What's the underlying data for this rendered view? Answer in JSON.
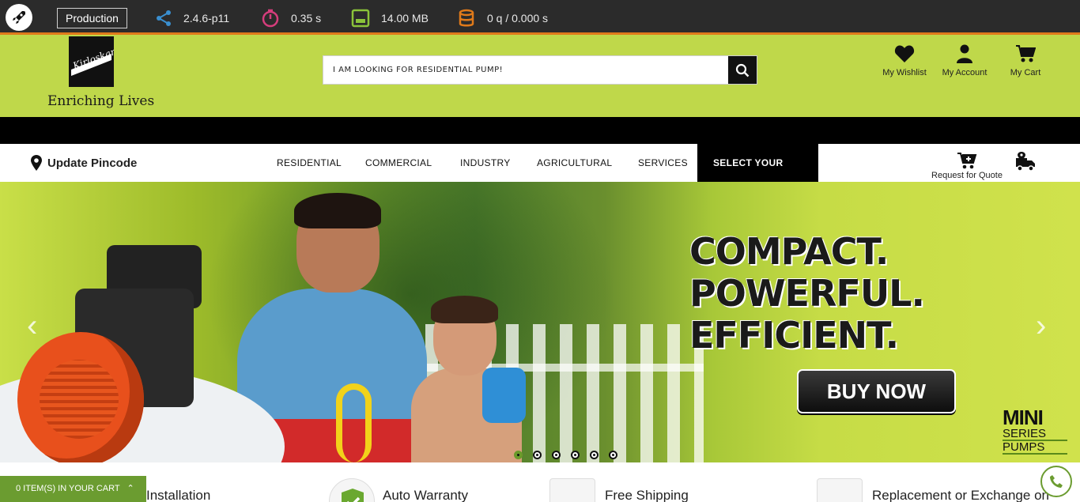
{
  "devbar": {
    "environment": "Production",
    "version": "2.4.6-p11",
    "time": "0.35 s",
    "memory": "14.00 MB",
    "queries": "0 q / 0.000 s"
  },
  "header": {
    "logo_script": "Kirloskar",
    "logo_tagline": "Enriching Lives",
    "search": {
      "value": "I AM LOOKING FOR RESIDENTIAL PUMP!",
      "icon": "search-icon"
    },
    "links": [
      {
        "label": "My Wishlist",
        "icon": "heart-icon"
      },
      {
        "label": "My Account",
        "icon": "user-icon"
      },
      {
        "label": "My Cart",
        "icon": "cart-icon"
      }
    ]
  },
  "nav": {
    "pincode": "Update Pincode",
    "items": [
      "RESIDENTIAL",
      "COMMERCIAL",
      "INDUSTRY",
      "AGRICULTURAL",
      "SERVICES",
      "SELECT YOUR PUMP"
    ],
    "active_item": "SELECT YOUR PUMP",
    "rfq": "Request for Quote"
  },
  "banner": {
    "line1": "COMPACT.",
    "line2": "POWERFUL.",
    "line3": "EFFICIENT.",
    "cta": "BUY NOW",
    "mini_title": "MINI",
    "mini_line2": "SERIES",
    "mini_line3": "PUMPS",
    "slides_total": 6,
    "active_slide": 1
  },
  "features": {
    "items": [
      "Installation",
      "Auto Warranty",
      "Free Shipping",
      "Replacement or Exchange on"
    ]
  },
  "cart_bar": {
    "label": "0 ITEM(S) IN YOUR CART"
  },
  "colors": {
    "header": "#bfd84a",
    "accent": "#6b9c30",
    "devbar": "#2b2b2b",
    "devbar_border": "#e07a1a"
  }
}
